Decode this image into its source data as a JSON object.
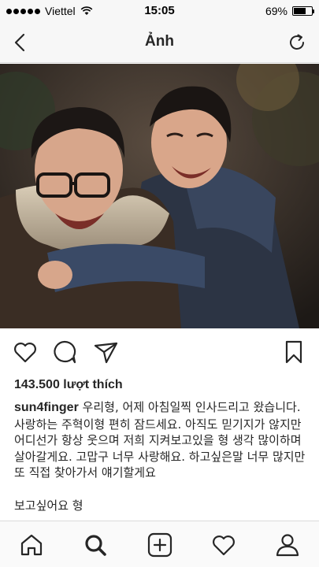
{
  "status": {
    "carrier": "Viettel",
    "time": "15:05",
    "battery_text": "69%",
    "battery_level": 0.69
  },
  "nav": {
    "title": "Ảnh"
  },
  "post": {
    "likes": "143.500 lượt thích",
    "username": "sun4finger",
    "caption": "우리형, 어제 아침일찍 인사드리고 왔습니다. 사랑하는 주혁이형 편히 잠드세요. 아직도 믿기지가 않지만 어디선가 항상 웃으며 저희 지켜보고있을 형 생각 많이하며 살아갈게요. 고맙구 너무 사랑해요. 하고싶은말 너무 많지만 또 직접 찾아가서 얘기할게요",
    "caption_2": "보고싶어요 형"
  },
  "icons": {
    "back": "chevron-left-icon",
    "refresh": "refresh-icon",
    "like": "heart-icon",
    "comment": "comment-icon",
    "share": "paper-plane-icon",
    "save": "bookmark-icon",
    "tab_home": "home-icon",
    "tab_search": "search-icon",
    "tab_add": "add-post-icon",
    "tab_activity": "heart-icon",
    "tab_profile": "profile-icon"
  },
  "colors": {
    "text": "#262626",
    "bar_bg": "#f7f7f7",
    "divider": "#dbdbdb"
  }
}
